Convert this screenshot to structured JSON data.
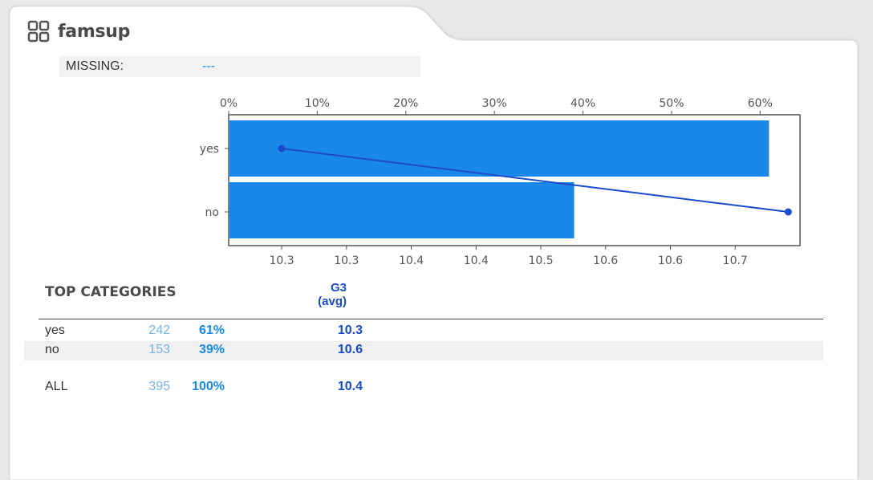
{
  "variable": {
    "name": "famsup",
    "icon": "grid-icon"
  },
  "missing": {
    "label": "MISSING:",
    "value": "---"
  },
  "colors": {
    "bar": "#1a88e8",
    "line": "#1a4bc8",
    "count": "#7ab3e6",
    "pct": "#1b8be8"
  },
  "chart_data": {
    "type": "bar",
    "orientation": "horizontal",
    "categories": [
      "yes",
      "no"
    ],
    "bar_percent": [
      61,
      39
    ],
    "line_values": [
      10.25,
      10.68
    ],
    "top_axis": {
      "ticks": [
        "0%",
        "10%",
        "20%",
        "30%",
        "40%",
        "50%",
        "60%"
      ],
      "range": [
        0,
        64.5
      ]
    },
    "bottom_axis": {
      "ticks": [
        "10.3",
        "10.3",
        "10.4",
        "10.4",
        "10.5",
        "10.6",
        "10.6",
        "10.7"
      ],
      "range": [
        10.205,
        10.69
      ]
    },
    "grid": false
  },
  "table": {
    "header": {
      "title": "TOP CATEGORIES",
      "g3_line1": "G3",
      "g3_line2": "(avg)"
    },
    "rows": [
      {
        "name": "yes",
        "count": "242",
        "pct": "61%",
        "avg": "10.3"
      },
      {
        "name": "no",
        "count": "153",
        "pct": "39%",
        "avg": "10.6"
      }
    ],
    "total": {
      "name": "ALL",
      "count": "395",
      "pct": "100%",
      "avg": "10.4"
    }
  }
}
